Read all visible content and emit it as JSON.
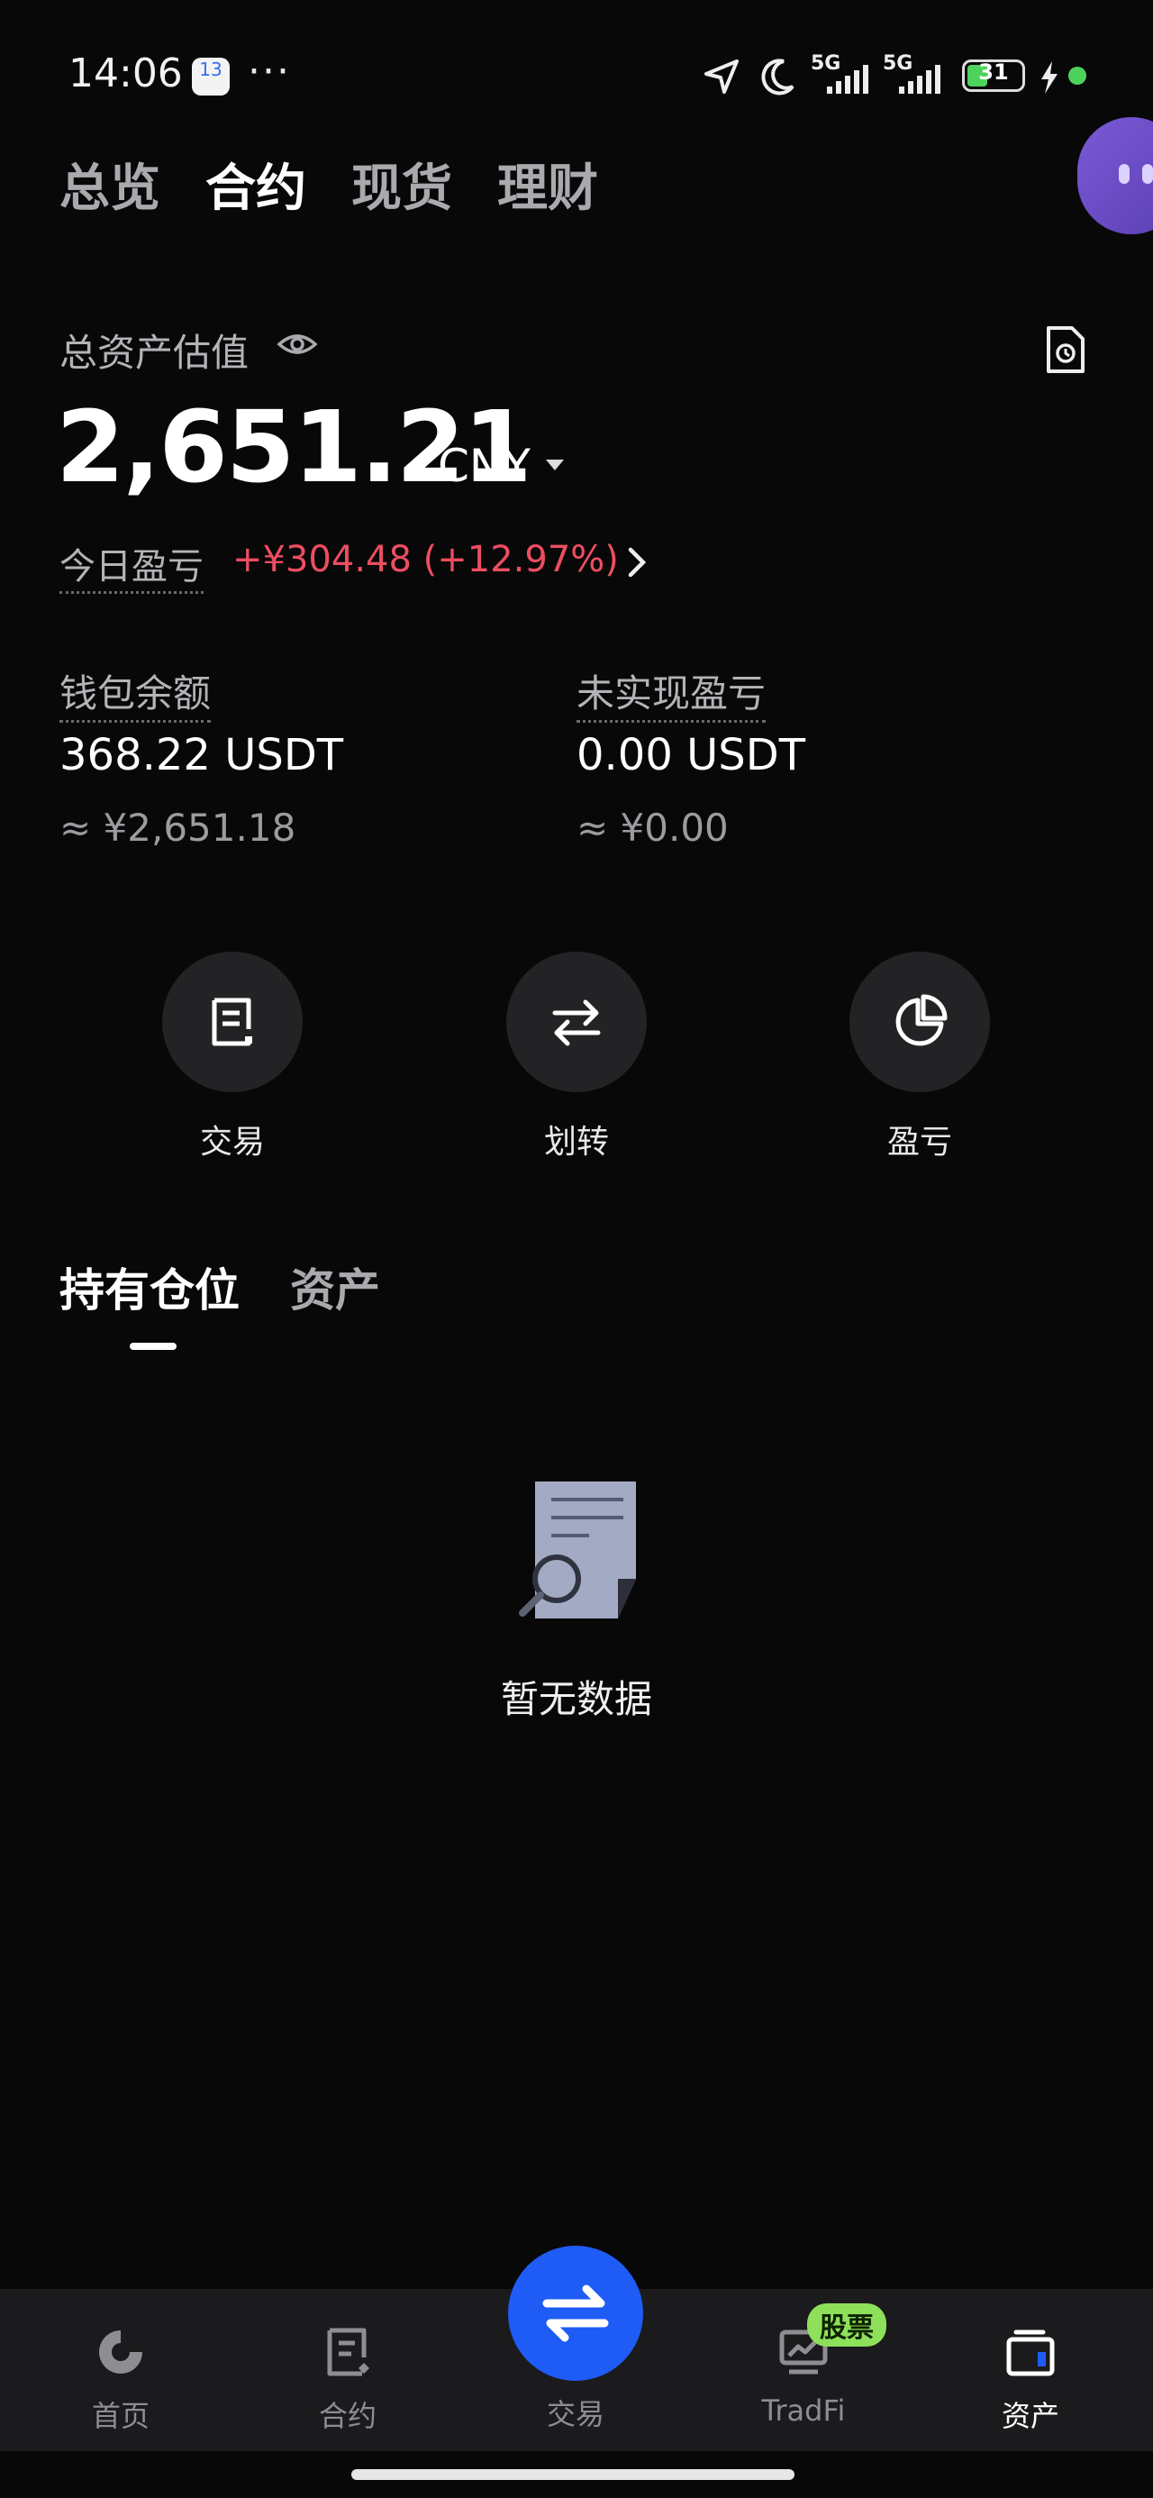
{
  "status_bar": {
    "time": "14:06",
    "calendar_day": "13",
    "more": "···",
    "signal1": "5G",
    "signal2": "5G",
    "battery": "31"
  },
  "top_tabs": [
    {
      "label": "总览",
      "active": false
    },
    {
      "label": "合约",
      "active": true
    },
    {
      "label": "现货",
      "active": false
    },
    {
      "label": "理财",
      "active": false
    }
  ],
  "summary": {
    "label": "总资产估值",
    "amount": "2,651.21",
    "currency": "CNY",
    "pnl_label": "今日盈亏",
    "pnl_value": "+¥304.48 (+12.97%)",
    "pnl_color": "#ee4d60"
  },
  "balances": {
    "wallet_label": "钱包余额",
    "wallet_value": "368.22 USDT",
    "wallet_cny": "≈ ¥2,651.18",
    "unreal_label": "未实现盈亏",
    "unreal_value": "0.00 USDT",
    "unreal_cny": "≈ ¥0.00"
  },
  "actions": [
    {
      "label": "交易",
      "icon": "order-doc-icon"
    },
    {
      "label": "划转",
      "icon": "transfer-icon"
    },
    {
      "label": "盈亏",
      "icon": "pie-chart-icon"
    }
  ],
  "section_tabs": [
    {
      "label": "持有仓位",
      "active": true
    },
    {
      "label": "资产",
      "active": false
    }
  ],
  "empty_state": {
    "text": "暂无数据",
    "icon": "empty-search-doc-icon"
  },
  "bottom_nav": {
    "items": [
      {
        "label": "首页",
        "icon": "home-icon"
      },
      {
        "label": "合约",
        "icon": "contract-icon"
      },
      {
        "label": "交易",
        "icon": "trade-swap-icon"
      },
      {
        "label": "TradFi",
        "icon": "tradfi-icon",
        "badge": "股票"
      },
      {
        "label": "资产",
        "icon": "wallet-icon",
        "active": true
      }
    ],
    "accent": "#1f5cf5",
    "badge_color": "#8ee05a"
  }
}
